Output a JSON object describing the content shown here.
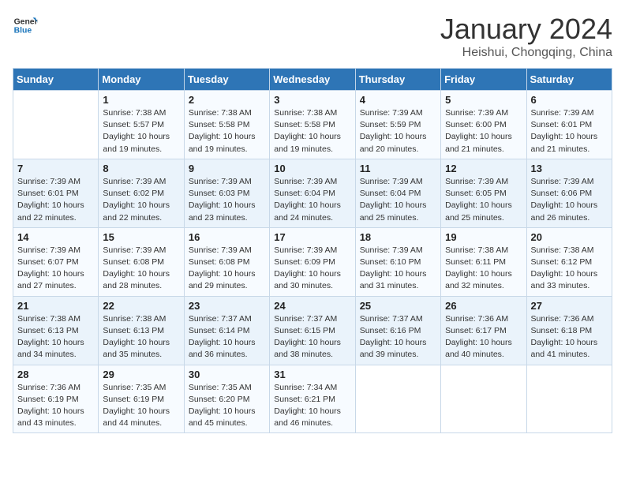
{
  "header": {
    "logo_general": "General",
    "logo_blue": "Blue",
    "month_title": "January 2024",
    "subtitle": "Heishui, Chongqing, China"
  },
  "days_of_week": [
    "Sunday",
    "Monday",
    "Tuesday",
    "Wednesday",
    "Thursday",
    "Friday",
    "Saturday"
  ],
  "weeks": [
    [
      {
        "num": "",
        "info": ""
      },
      {
        "num": "1",
        "info": "Sunrise: 7:38 AM\nSunset: 5:57 PM\nDaylight: 10 hours\nand 19 minutes."
      },
      {
        "num": "2",
        "info": "Sunrise: 7:38 AM\nSunset: 5:58 PM\nDaylight: 10 hours\nand 19 minutes."
      },
      {
        "num": "3",
        "info": "Sunrise: 7:38 AM\nSunset: 5:58 PM\nDaylight: 10 hours\nand 19 minutes."
      },
      {
        "num": "4",
        "info": "Sunrise: 7:39 AM\nSunset: 5:59 PM\nDaylight: 10 hours\nand 20 minutes."
      },
      {
        "num": "5",
        "info": "Sunrise: 7:39 AM\nSunset: 6:00 PM\nDaylight: 10 hours\nand 21 minutes."
      },
      {
        "num": "6",
        "info": "Sunrise: 7:39 AM\nSunset: 6:01 PM\nDaylight: 10 hours\nand 21 minutes."
      }
    ],
    [
      {
        "num": "7",
        "info": "Sunrise: 7:39 AM\nSunset: 6:01 PM\nDaylight: 10 hours\nand 22 minutes."
      },
      {
        "num": "8",
        "info": "Sunrise: 7:39 AM\nSunset: 6:02 PM\nDaylight: 10 hours\nand 22 minutes."
      },
      {
        "num": "9",
        "info": "Sunrise: 7:39 AM\nSunset: 6:03 PM\nDaylight: 10 hours\nand 23 minutes."
      },
      {
        "num": "10",
        "info": "Sunrise: 7:39 AM\nSunset: 6:04 PM\nDaylight: 10 hours\nand 24 minutes."
      },
      {
        "num": "11",
        "info": "Sunrise: 7:39 AM\nSunset: 6:04 PM\nDaylight: 10 hours\nand 25 minutes."
      },
      {
        "num": "12",
        "info": "Sunrise: 7:39 AM\nSunset: 6:05 PM\nDaylight: 10 hours\nand 25 minutes."
      },
      {
        "num": "13",
        "info": "Sunrise: 7:39 AM\nSunset: 6:06 PM\nDaylight: 10 hours\nand 26 minutes."
      }
    ],
    [
      {
        "num": "14",
        "info": "Sunrise: 7:39 AM\nSunset: 6:07 PM\nDaylight: 10 hours\nand 27 minutes."
      },
      {
        "num": "15",
        "info": "Sunrise: 7:39 AM\nSunset: 6:08 PM\nDaylight: 10 hours\nand 28 minutes."
      },
      {
        "num": "16",
        "info": "Sunrise: 7:39 AM\nSunset: 6:08 PM\nDaylight: 10 hours\nand 29 minutes."
      },
      {
        "num": "17",
        "info": "Sunrise: 7:39 AM\nSunset: 6:09 PM\nDaylight: 10 hours\nand 30 minutes."
      },
      {
        "num": "18",
        "info": "Sunrise: 7:39 AM\nSunset: 6:10 PM\nDaylight: 10 hours\nand 31 minutes."
      },
      {
        "num": "19",
        "info": "Sunrise: 7:38 AM\nSunset: 6:11 PM\nDaylight: 10 hours\nand 32 minutes."
      },
      {
        "num": "20",
        "info": "Sunrise: 7:38 AM\nSunset: 6:12 PM\nDaylight: 10 hours\nand 33 minutes."
      }
    ],
    [
      {
        "num": "21",
        "info": "Sunrise: 7:38 AM\nSunset: 6:13 PM\nDaylight: 10 hours\nand 34 minutes."
      },
      {
        "num": "22",
        "info": "Sunrise: 7:38 AM\nSunset: 6:13 PM\nDaylight: 10 hours\nand 35 minutes."
      },
      {
        "num": "23",
        "info": "Sunrise: 7:37 AM\nSunset: 6:14 PM\nDaylight: 10 hours\nand 36 minutes."
      },
      {
        "num": "24",
        "info": "Sunrise: 7:37 AM\nSunset: 6:15 PM\nDaylight: 10 hours\nand 38 minutes."
      },
      {
        "num": "25",
        "info": "Sunrise: 7:37 AM\nSunset: 6:16 PM\nDaylight: 10 hours\nand 39 minutes."
      },
      {
        "num": "26",
        "info": "Sunrise: 7:36 AM\nSunset: 6:17 PM\nDaylight: 10 hours\nand 40 minutes."
      },
      {
        "num": "27",
        "info": "Sunrise: 7:36 AM\nSunset: 6:18 PM\nDaylight: 10 hours\nand 41 minutes."
      }
    ],
    [
      {
        "num": "28",
        "info": "Sunrise: 7:36 AM\nSunset: 6:19 PM\nDaylight: 10 hours\nand 43 minutes."
      },
      {
        "num": "29",
        "info": "Sunrise: 7:35 AM\nSunset: 6:19 PM\nDaylight: 10 hours\nand 44 minutes."
      },
      {
        "num": "30",
        "info": "Sunrise: 7:35 AM\nSunset: 6:20 PM\nDaylight: 10 hours\nand 45 minutes."
      },
      {
        "num": "31",
        "info": "Sunrise: 7:34 AM\nSunset: 6:21 PM\nDaylight: 10 hours\nand 46 minutes."
      },
      {
        "num": "",
        "info": ""
      },
      {
        "num": "",
        "info": ""
      },
      {
        "num": "",
        "info": ""
      }
    ]
  ]
}
